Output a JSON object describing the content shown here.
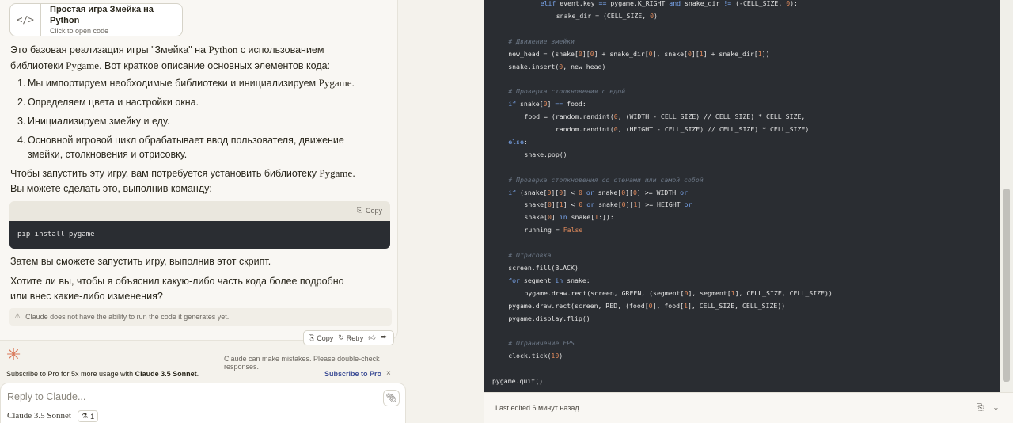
{
  "artifact": {
    "icon": "code-icon",
    "title": "Простая игра Змейка на Python",
    "subtitle": "Click to open code"
  },
  "message": {
    "intro_1": "Это базовая реализация игры \"Змейка\" на ",
    "intro_python": "Python",
    "intro_2": " с использованием библиотеки",
    "intro_pygame": "Pygame",
    "intro_3": ". Вот краткое описание основных элементов кода:",
    "list": [
      {
        "num": "1.",
        "text_a": "Мы импортируем необходимые библиотеки и инициализируем ",
        "text_b": "Pygame",
        "text_c": "."
      },
      {
        "num": "2.",
        "text_a": "Определяем цвета и настройки окна.",
        "text_b": "",
        "text_c": ""
      },
      {
        "num": "3.",
        "text_a": "Инициализируем змейку и еду.",
        "text_b": "",
        "text_c": ""
      },
      {
        "num": "4.",
        "text_a": "Основной игровой цикл обрабатывает ввод пользователя, движение змейки, столкновения и отрисовку.",
        "text_b": "",
        "text_c": ""
      }
    ],
    "install_1": "Чтобы запустить эту игру, вам потребуется установить библиотеку ",
    "install_pygame": "Pygame",
    "install_2": ". Вы можете сделать это, выполнив команду:",
    "copy_label": "Copy",
    "command": "pip install pygame",
    "run_text": "Затем вы сможете запустить игру, выполнив этот скрипт.",
    "question": "Хотите ли вы, чтобы я объяснил какую-либо часть кода более подробно или внес какие-либо изменения?",
    "disclaimer": "Claude does not have the ability to run the code it generates yet."
  },
  "actions": {
    "copy": "Copy",
    "retry": "Retry"
  },
  "notice": "Claude can make mistakes. Please double-check responses.",
  "promo": {
    "text_a": "Subscribe to Pro for 5x more usage with ",
    "text_b": "Claude 3.5 Sonnet",
    "text_c": ".",
    "link": "Subscribe to Pro",
    "close": "×"
  },
  "composer": {
    "placeholder": "Reply to Claude...",
    "model": "Claude 3.5 Sonnet",
    "badge_count": "1"
  },
  "code_lines": [
    {
      "indent": 3,
      "parts": [
        [
          "kw",
          "elif "
        ],
        [
          "fn",
          "event.key "
        ],
        [
          "kw",
          "=="
        ],
        [
          "fn",
          " pygame.K_RIGHT "
        ],
        [
          "kw",
          "and"
        ],
        [
          "fn",
          " snake_dir "
        ],
        [
          "kw",
          "!="
        ],
        [
          "fn",
          " (-CELL_SIZE, "
        ],
        [
          "nm",
          "0"
        ],
        [
          "fn",
          "):"
        ]
      ]
    },
    {
      "indent": 4,
      "parts": [
        [
          "fn",
          "snake_dir = (CELL_SIZE, "
        ],
        [
          "nm",
          "0"
        ],
        [
          "fn",
          ")"
        ]
      ]
    },
    {
      "indent": 0,
      "parts": []
    },
    {
      "indent": 1,
      "parts": [
        [
          "cm",
          "# Движение змейки"
        ]
      ]
    },
    {
      "indent": 1,
      "parts": [
        [
          "fn",
          "new_head = (snake["
        ],
        [
          "nm",
          "0"
        ],
        [
          "fn",
          "]["
        ],
        [
          "nm",
          "0"
        ],
        [
          "fn",
          "] + snake_dir["
        ],
        [
          "nm",
          "0"
        ],
        [
          "fn",
          "], snake["
        ],
        [
          "nm",
          "0"
        ],
        [
          "fn",
          "]["
        ],
        [
          "nm",
          "1"
        ],
        [
          "fn",
          "] + snake_dir["
        ],
        [
          "nm",
          "1"
        ],
        [
          "fn",
          "])"
        ]
      ]
    },
    {
      "indent": 1,
      "parts": [
        [
          "fn",
          "snake.insert("
        ],
        [
          "nm",
          "0"
        ],
        [
          "fn",
          ", new_head)"
        ]
      ]
    },
    {
      "indent": 0,
      "parts": []
    },
    {
      "indent": 1,
      "parts": [
        [
          "cm",
          "# Проверка столкновения с едой"
        ]
      ]
    },
    {
      "indent": 1,
      "parts": [
        [
          "kw",
          "if"
        ],
        [
          "fn",
          " snake["
        ],
        [
          "nm",
          "0"
        ],
        [
          "fn",
          "] "
        ],
        [
          "kw",
          "=="
        ],
        [
          "fn",
          " food:"
        ]
      ]
    },
    {
      "indent": 2,
      "parts": [
        [
          "fn",
          "food = (random.randint("
        ],
        [
          "nm",
          "0"
        ],
        [
          "fn",
          ", (WIDTH - CELL_SIZE) // CELL_SIZE) * CELL_SIZE,"
        ]
      ]
    },
    {
      "indent": 2,
      "pad": "        ",
      "parts": [
        [
          "fn",
          "random.randint("
        ],
        [
          "nm",
          "0"
        ],
        [
          "fn",
          ", (HEIGHT - CELL_SIZE) // CELL_SIZE) * CELL_SIZE)"
        ]
      ]
    },
    {
      "indent": 1,
      "parts": [
        [
          "kw",
          "else"
        ],
        [
          "fn",
          ":"
        ]
      ]
    },
    {
      "indent": 2,
      "parts": [
        [
          "fn",
          "snake.pop()"
        ]
      ]
    },
    {
      "indent": 0,
      "parts": []
    },
    {
      "indent": 1,
      "parts": [
        [
          "cm",
          "# Проверка столкновения со стенами или самой собой"
        ]
      ]
    },
    {
      "indent": 1,
      "parts": [
        [
          "kw",
          "if"
        ],
        [
          "fn",
          " (snake["
        ],
        [
          "nm",
          "0"
        ],
        [
          "fn",
          "]["
        ],
        [
          "nm",
          "0"
        ],
        [
          "fn",
          "] < "
        ],
        [
          "nm",
          "0"
        ],
        [
          "fn",
          " "
        ],
        [
          "kw",
          "or"
        ],
        [
          "fn",
          " snake["
        ],
        [
          "nm",
          "0"
        ],
        [
          "fn",
          "]["
        ],
        [
          "nm",
          "0"
        ],
        [
          "fn",
          "] >= WIDTH "
        ],
        [
          "kw",
          "or"
        ]
      ]
    },
    {
      "indent": 2,
      "parts": [
        [
          "fn",
          "snake["
        ],
        [
          "nm",
          "0"
        ],
        [
          "fn",
          "]["
        ],
        [
          "nm",
          "1"
        ],
        [
          "fn",
          "] < "
        ],
        [
          "nm",
          "0"
        ],
        [
          "fn",
          " "
        ],
        [
          "kw",
          "or"
        ],
        [
          "fn",
          " snake["
        ],
        [
          "nm",
          "0"
        ],
        [
          "fn",
          "]["
        ],
        [
          "nm",
          "1"
        ],
        [
          "fn",
          "] >= HEIGHT "
        ],
        [
          "kw",
          "or"
        ]
      ]
    },
    {
      "indent": 2,
      "parts": [
        [
          "fn",
          "snake["
        ],
        [
          "nm",
          "0"
        ],
        [
          "fn",
          "] "
        ],
        [
          "kw",
          "in"
        ],
        [
          "fn",
          " snake["
        ],
        [
          "nm",
          "1"
        ],
        [
          "fn",
          ":]):"
        ]
      ]
    },
    {
      "indent": 2,
      "parts": [
        [
          "fn",
          "running = "
        ],
        [
          "nm",
          "False"
        ]
      ]
    },
    {
      "indent": 0,
      "parts": []
    },
    {
      "indent": 1,
      "parts": [
        [
          "cm",
          "# Отрисовка"
        ]
      ]
    },
    {
      "indent": 1,
      "parts": [
        [
          "fn",
          "screen.fill(BLACK)"
        ]
      ]
    },
    {
      "indent": 1,
      "parts": [
        [
          "kw",
          "for"
        ],
        [
          "fn",
          " segment "
        ],
        [
          "kw",
          "in"
        ],
        [
          "fn",
          " snake:"
        ]
      ]
    },
    {
      "indent": 2,
      "parts": [
        [
          "fn",
          "pygame.draw.rect(screen, GREEN, (segment["
        ],
        [
          "nm",
          "0"
        ],
        [
          "fn",
          "], segment["
        ],
        [
          "nm",
          "1"
        ],
        [
          "fn",
          "], CELL_SIZE, CELL_SIZE))"
        ]
      ]
    },
    {
      "indent": 1,
      "parts": [
        [
          "fn",
          "pygame.draw.rect(screen, RED, (food["
        ],
        [
          "nm",
          "0"
        ],
        [
          "fn",
          "], food["
        ],
        [
          "nm",
          "1"
        ],
        [
          "fn",
          "], CELL_SIZE, CELL_SIZE))"
        ]
      ]
    },
    {
      "indent": 1,
      "parts": [
        [
          "fn",
          "pygame.display.flip()"
        ]
      ]
    },
    {
      "indent": 0,
      "parts": []
    },
    {
      "indent": 1,
      "parts": [
        [
          "cm",
          "# Ограничение FPS"
        ]
      ]
    },
    {
      "indent": 1,
      "parts": [
        [
          "fn",
          "clock.tick("
        ],
        [
          "nm",
          "10"
        ],
        [
          "fn",
          ")"
        ]
      ]
    },
    {
      "indent": 0,
      "parts": []
    },
    {
      "indent": 0,
      "parts": [
        [
          "fn",
          "pygame.quit()"
        ]
      ]
    }
  ],
  "footer": {
    "edited": "Last edited 6 минут назад",
    "icons": [
      "copy-icon",
      "download-icon"
    ]
  }
}
